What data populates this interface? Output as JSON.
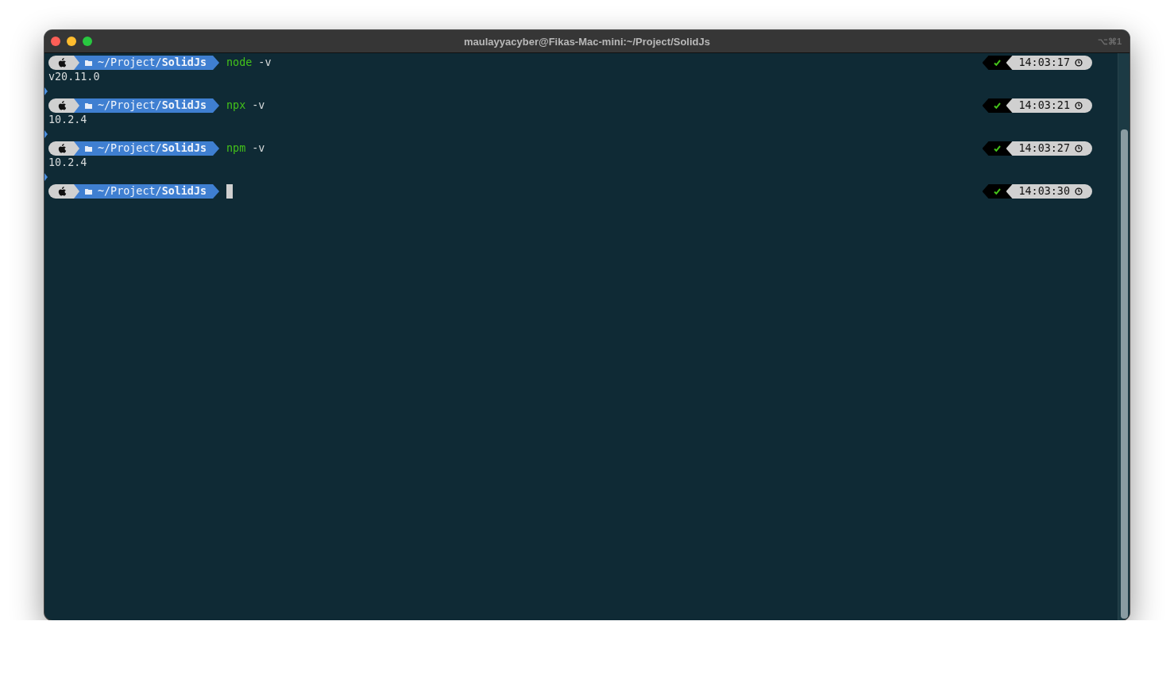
{
  "window": {
    "title": "maulayyacyber@Fikas-Mac-mini:~/Project/SolidJs",
    "shortcut": "⌥⌘1"
  },
  "prompts": [
    {
      "path": "~/Project/",
      "folder": "SolidJs",
      "command": "node",
      "args": "-v",
      "output": "v20.11.0",
      "time": "14:03:17",
      "succeeded": true,
      "cursor": false
    },
    {
      "path": "~/Project/",
      "folder": "SolidJs",
      "command": "npx",
      "args": "-v",
      "output": "10.2.4",
      "time": "14:03:21",
      "succeeded": true,
      "cursor": false
    },
    {
      "path": "~/Project/",
      "folder": "SolidJs",
      "command": "npm",
      "args": "-v",
      "output": "10.2.4",
      "time": "14:03:27",
      "succeeded": true,
      "cursor": false
    },
    {
      "path": "~/Project/",
      "folder": "SolidJs",
      "time": "14:03:30",
      "succeeded": true,
      "cursor": true
    }
  ]
}
